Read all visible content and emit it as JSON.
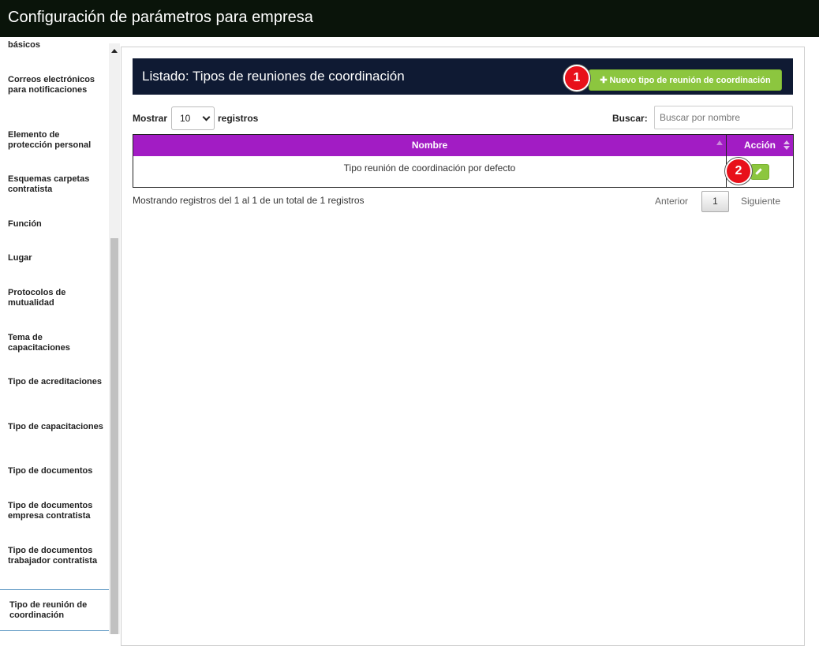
{
  "window": {
    "title": "Configuración de parámetros para empresa"
  },
  "sidebar": {
    "partial_top": "básicos",
    "items": [
      "Correos electrónicos para notificaciones",
      "Elemento de protección personal",
      "Esquemas carpetas contratista",
      "Función",
      "Lugar",
      "Protocolos de mutualidad",
      "Tema de capacitaciones",
      "Tipo de acreditaciones",
      "Tipo de capacitaciones",
      "Tipo de documentos",
      "Tipo de documentos empresa contratista",
      "Tipo de documentos trabajador contratista"
    ],
    "active_item": "Tipo de reunión de coordinación"
  },
  "listing": {
    "title": "Listado: Tipos de reuniones de coordinación",
    "new_button_label": "Nuevo tipo de reunión de coordinación",
    "new_button_icon": "plus-icon"
  },
  "badges": {
    "one": "1",
    "two": "2"
  },
  "controls": {
    "show_label": "Mostrar",
    "page_size": "10",
    "records_label": "registros",
    "search_label": "Buscar:",
    "search_placeholder": "Buscar por nombre"
  },
  "table": {
    "headers": {
      "name": "Nombre",
      "action": "Acción"
    },
    "rows": [
      {
        "name": "Tipo reunión de coordinación por defecto",
        "action_icon": "pencil-icon"
      }
    ]
  },
  "footer": {
    "info": "Mostrando registros del 1 al 1 de un total de 1 registros",
    "prev": "Anterior",
    "page": "1",
    "next": "Siguiente"
  },
  "colors": {
    "topbar": "#0a140a",
    "header_band": "#0f1a33",
    "table_header": "#a21cc4",
    "button_green": "#8cc63f",
    "badge_red": "#e8101a"
  }
}
